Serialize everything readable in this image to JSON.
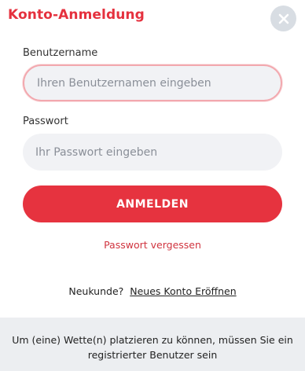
{
  "header": {
    "title": "Konto-Anmeldung",
    "close_icon": "close-icon"
  },
  "form": {
    "username_label": "Benutzername",
    "username_placeholder": "Ihren Benutzernamen eingeben",
    "username_value": "",
    "password_label": "Passwort",
    "password_placeholder": "Ihr Passwort eingeben",
    "password_value": "",
    "login_button": "ANMELDEN",
    "forgot_password": "Passwort vergessen"
  },
  "register": {
    "prompt": "Neukunde?",
    "link": "Neues Konto Eröffnen"
  },
  "footer": {
    "notice": "Um (eine) Wette(n) platzieren zu können, müssen Sie ein registrierter Benutzer sein"
  },
  "colors": {
    "accent": "#e6333f",
    "input_bg": "#f1f2f5",
    "footer_bg": "#eceef1",
    "focus_border": "#f2a8ae"
  }
}
